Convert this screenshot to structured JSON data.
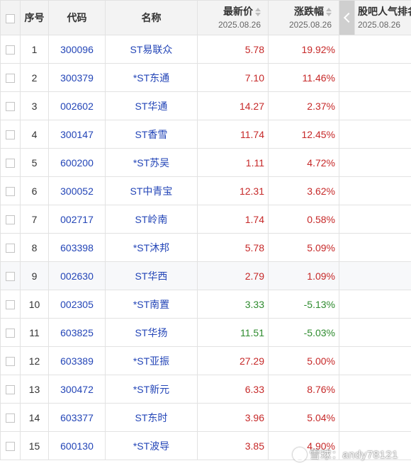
{
  "headers": {
    "index": "序号",
    "code": "代码",
    "name": "名称",
    "price": "最新价",
    "change": "涨跌幅",
    "date": "2025.08.26",
    "extra": "股吧人气排名"
  },
  "colors": {
    "up": "#c62828",
    "down": "#2e8b2e",
    "link": "#2345b7"
  },
  "rows": [
    {
      "index": "1",
      "code": "300096",
      "name": "ST易联众",
      "price": "5.78",
      "change": "19.92%",
      "dir": "up"
    },
    {
      "index": "2",
      "code": "300379",
      "name": "*ST东通",
      "price": "7.10",
      "change": "11.46%",
      "dir": "up"
    },
    {
      "index": "3",
      "code": "002602",
      "name": "ST华通",
      "price": "14.27",
      "change": "2.37%",
      "dir": "up"
    },
    {
      "index": "4",
      "code": "300147",
      "name": "ST香雪",
      "price": "11.74",
      "change": "12.45%",
      "dir": "up"
    },
    {
      "index": "5",
      "code": "600200",
      "name": "*ST苏吴",
      "price": "1.11",
      "change": "4.72%",
      "dir": "up"
    },
    {
      "index": "6",
      "code": "300052",
      "name": "ST中青宝",
      "price": "12.31",
      "change": "3.62%",
      "dir": "up"
    },
    {
      "index": "7",
      "code": "002717",
      "name": "ST岭南",
      "price": "1.74",
      "change": "0.58%",
      "dir": "up"
    },
    {
      "index": "8",
      "code": "603398",
      "name": "*ST沐邦",
      "price": "5.78",
      "change": "5.09%",
      "dir": "up"
    },
    {
      "index": "9",
      "code": "002630",
      "name": "ST华西",
      "price": "2.79",
      "change": "1.09%",
      "dir": "up"
    },
    {
      "index": "10",
      "code": "002305",
      "name": "*ST南置",
      "price": "3.33",
      "change": "-5.13%",
      "dir": "down"
    },
    {
      "index": "11",
      "code": "603825",
      "name": "ST华扬",
      "price": "11.51",
      "change": "-5.03%",
      "dir": "down"
    },
    {
      "index": "12",
      "code": "603389",
      "name": "*ST亚振",
      "price": "27.29",
      "change": "5.00%",
      "dir": "up"
    },
    {
      "index": "13",
      "code": "300472",
      "name": "*ST新元",
      "price": "6.33",
      "change": "8.76%",
      "dir": "up"
    },
    {
      "index": "14",
      "code": "603377",
      "name": "ST东时",
      "price": "3.96",
      "change": "5.04%",
      "dir": "up"
    },
    {
      "index": "15",
      "code": "600130",
      "name": "*ST波导",
      "price": "3.85",
      "change": "4.90%",
      "dir": "up"
    }
  ],
  "watermark": "雪球：andy78121"
}
